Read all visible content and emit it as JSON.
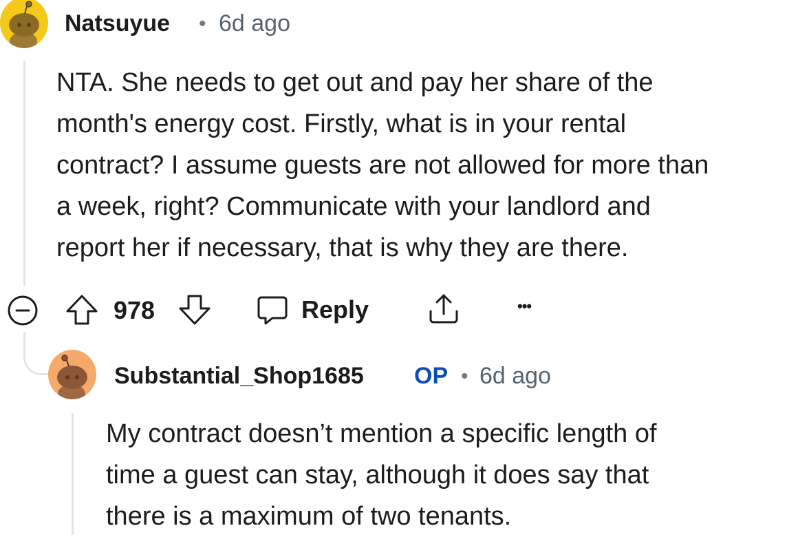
{
  "comment": {
    "author": "Natsuyue",
    "separator": "•",
    "timestamp": "6d ago",
    "body_lines": [
      "NTA. She needs to get out and pay her share of the",
      "month's energy cost. Firstly, what is in your rental",
      "contract? I assume guests are not allowed for more than",
      "a week, right? Communicate with your landlord and",
      "report her if necessary, that is why they are there."
    ],
    "vote_count": "978",
    "reply_label": "Reply",
    "more_label": "•••",
    "avatar_color": "#f5c91a"
  },
  "reply": {
    "author": "Substantial_Shop1685",
    "op_badge": "OP",
    "separator": "•",
    "timestamp": "6d ago",
    "body_lines": [
      "My contract doesn’t mention a specific length of",
      "time a guest can stay, although it does say that",
      "there is a maximum of two tenants."
    ],
    "avatar_color": "#f5a96a"
  },
  "icons": {
    "collapse": "collapse-minus-icon",
    "upvote": "upvote-arrow-icon",
    "downvote": "downvote-arrow-icon",
    "reply": "speech-bubble-icon",
    "share": "share-icon",
    "more": "more-dots-icon"
  }
}
